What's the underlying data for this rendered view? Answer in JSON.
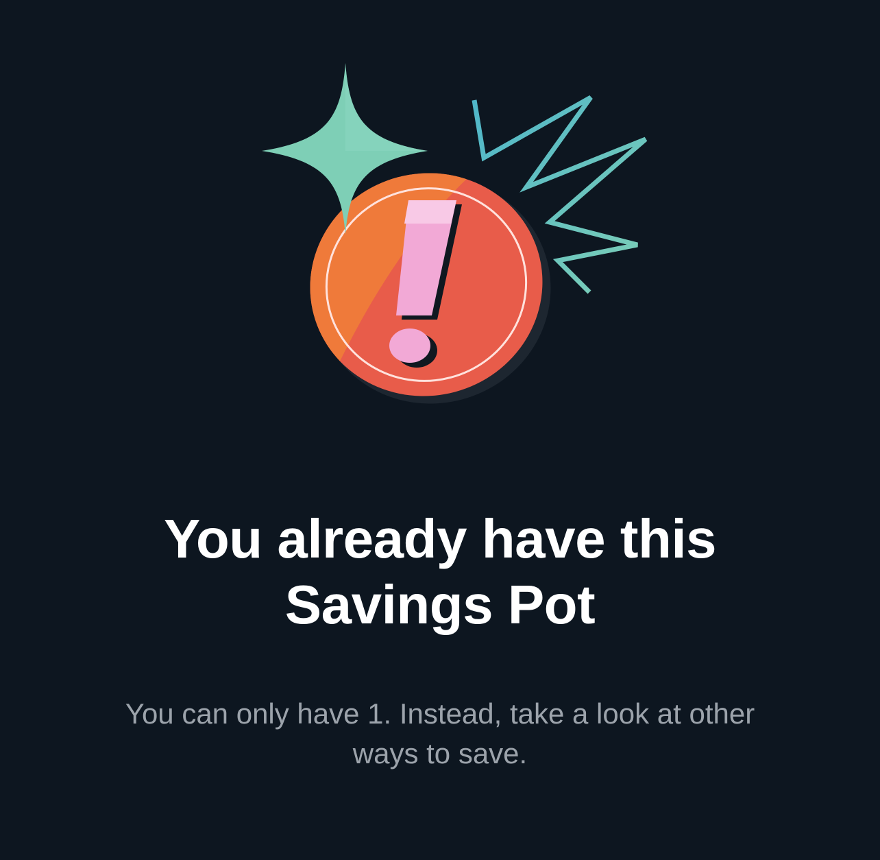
{
  "dialog": {
    "illustration": {
      "icon": "exclamation-coin-icon",
      "sparkle_icon": "sparkle-icon",
      "burst_icon": "zigzag-burst-icon",
      "colors": {
        "coin_orange": "#ef7a3a",
        "coin_red": "#e85c4a",
        "exclamation_pink": "#f2a9d6",
        "sparkle_mint": "#7ecfb6",
        "burst_teal": "#4fb6c9",
        "background": "#0d1620"
      }
    },
    "title_line1": "You already have this",
    "title_line2": "Savings Pot",
    "message_line1": "You can only have 1. Instead, take a look at other",
    "message_line2": "ways to save."
  }
}
